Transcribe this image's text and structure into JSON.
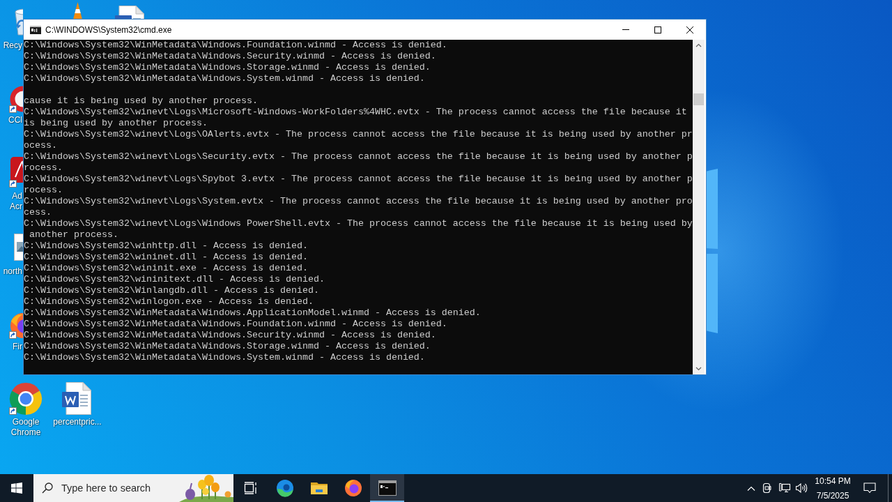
{
  "desktop": {
    "icons": [
      {
        "kind": "recycle-bin",
        "label": "Recy",
        "shortcut": false
      },
      {
        "kind": "cone",
        "shortcut": false
      },
      {
        "kind": "word-document",
        "shortcut": false
      },
      {
        "kind": "cleaner",
        "label": "CCl",
        "shortcut": true
      },
      {
        "kind": "pdf-reader",
        "label": "Ad Acr",
        "shortcut": true
      },
      {
        "kind": "image-file",
        "label": "north",
        "shortcut": false
      },
      {
        "kind": "firefox",
        "label": "Fir",
        "shortcut": true
      },
      {
        "kind": "chrome",
        "label": "Google Chrome",
        "shortcut": true
      },
      {
        "kind": "word-document",
        "label": "percentpric...",
        "shortcut": false
      }
    ]
  },
  "console_window": {
    "title": "C:\\WINDOWS\\System32\\cmd.exe",
    "output_blocks": [
      [
        "C:\\Windows\\System32\\WinMetadata\\Windows.Foundation.winmd - Access is denied.",
        "C:\\Windows\\System32\\WinMetadata\\Windows.Security.winmd - Access is denied.",
        "C:\\Windows\\System32\\WinMetadata\\Windows.Storage.winmd - Access is denied.",
        "C:\\Windows\\System32\\WinMetadata\\Windows.System.winmd - Access is denied."
      ],
      [
        "cause it is being used by another process.",
        "C:\\Windows\\System32\\winevt\\Logs\\Microsoft-Windows-WorkFolders%4WHC.evtx - The process cannot access the file because it",
        "is being used by another process.",
        "C:\\Windows\\System32\\winevt\\Logs\\OAlerts.evtx - The process cannot access the file because it is being used by another pr",
        "ocess.",
        "C:\\Windows\\System32\\winevt\\Logs\\Security.evtx - The process cannot access the file because it is being used by another p",
        "rocess.",
        "C:\\Windows\\System32\\winevt\\Logs\\Spybot 3.evtx - The process cannot access the file because it is being used by another p",
        "rocess.",
        "C:\\Windows\\System32\\winevt\\Logs\\System.evtx - The process cannot access the file because it is being used by another pro",
        "cess.",
        "C:\\Windows\\System32\\winevt\\Logs\\Windows PowerShell.evtx - The process cannot access the file because it is being used by",
        " another process.",
        "C:\\Windows\\System32\\winhttp.dll - Access is denied.",
        "C:\\Windows\\System32\\wininet.dll - Access is denied.",
        "C:\\Windows\\System32\\wininit.exe - Access is denied.",
        "C:\\Windows\\System32\\wininitext.dll - Access is denied.",
        "C:\\Windows\\System32\\Winlangdb.dll - Access is denied.",
        "C:\\Windows\\System32\\winlogon.exe - Access is denied.",
        "C:\\Windows\\System32\\WinMetadata\\Windows.ApplicationModel.winmd - Access is denied.",
        "C:\\Windows\\System32\\WinMetadata\\Windows.Foundation.winmd - Access is denied.",
        "C:\\Windows\\System32\\WinMetadata\\Windows.Security.winmd - Access is denied.",
        "C:\\Windows\\System32\\WinMetadata\\Windows.Storage.winmd - Access is denied.",
        "C:\\Windows\\System32\\WinMetadata\\Windows.System.winmd - Access is denied."
      ]
    ]
  },
  "taskbar": {
    "search": {
      "placeholder": "Type here to search"
    },
    "apps": [
      {
        "kind": "edge",
        "selected": false
      },
      {
        "kind": "file-explorer",
        "selected": false
      },
      {
        "kind": "firefox",
        "selected": false
      },
      {
        "kind": "terminal",
        "selected": true
      }
    ],
    "clock": {
      "time": "10:54 PM",
      "date": "7/5/2025"
    }
  }
}
